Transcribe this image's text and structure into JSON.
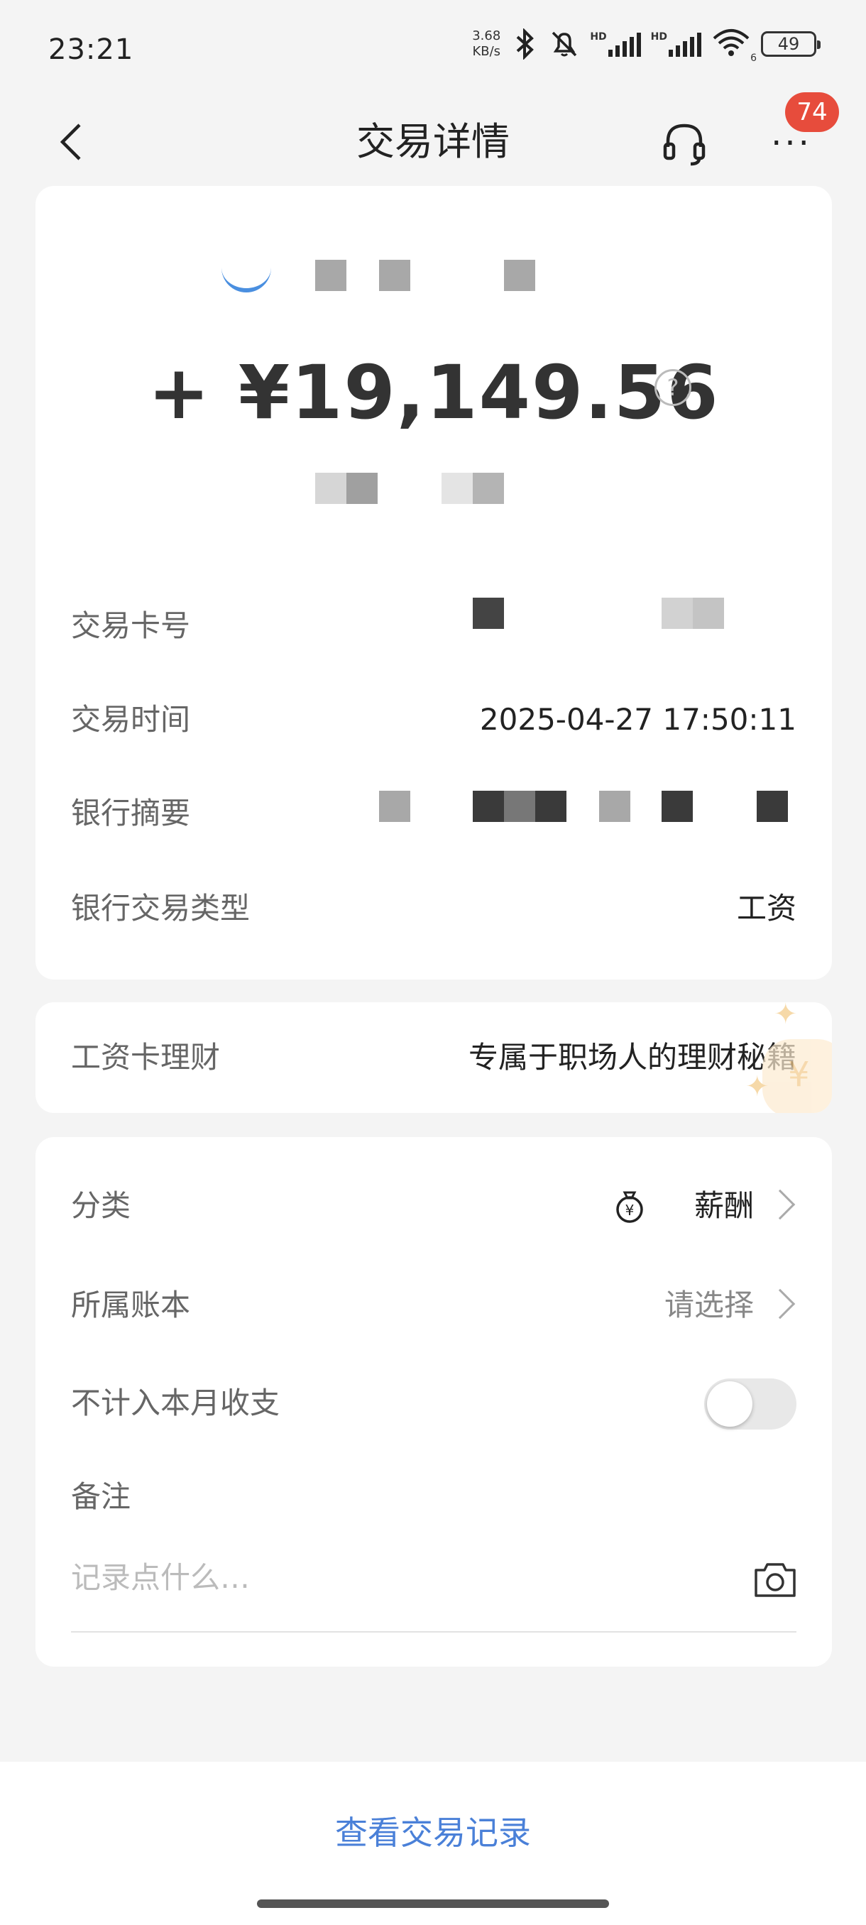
{
  "status_bar": {
    "time": "23:21",
    "net_speed_value": "3.68",
    "net_speed_unit": "KB/s",
    "hd_label": "HD",
    "wifi_index": "6",
    "battery": "49",
    "icons": [
      "bluetooth-icon",
      "mute-bell-icon",
      "signal-icon",
      "signal-icon",
      "wifi-icon",
      "battery-icon"
    ]
  },
  "nav": {
    "title": "交易详情",
    "badge_count": "74",
    "more_label": "···"
  },
  "transaction": {
    "amount": "+ ¥19,149.56",
    "help_label": "?",
    "details": [
      {
        "label": "交易卡号",
        "value": ""
      },
      {
        "label": "交易时间",
        "value": "2025-04-27 17:50:11"
      },
      {
        "label": "银行摘要",
        "value": ""
      },
      {
        "label": "银行交易类型",
        "value": "工资"
      }
    ]
  },
  "promo": {
    "label": "工资卡理财",
    "value": "专属于职场人的理财秘籍",
    "deco_glyph": "¥"
  },
  "edit": {
    "category_label": "分类",
    "category_value": "薪酬",
    "category_icon_glyph": "¥",
    "ledger_label": "所属账本",
    "ledger_value": "请选择",
    "exclude_label": "不计入本月收支",
    "exclude_enabled": false,
    "memo_label": "备注",
    "memo_placeholder": "记录点什么…"
  },
  "bottom": {
    "view_records": "查看交易记录"
  },
  "colors": {
    "accent_blue": "#4a80d8",
    "badge_red": "#e74c3c",
    "background": "#f4f4f4",
    "card": "#ffffff"
  }
}
